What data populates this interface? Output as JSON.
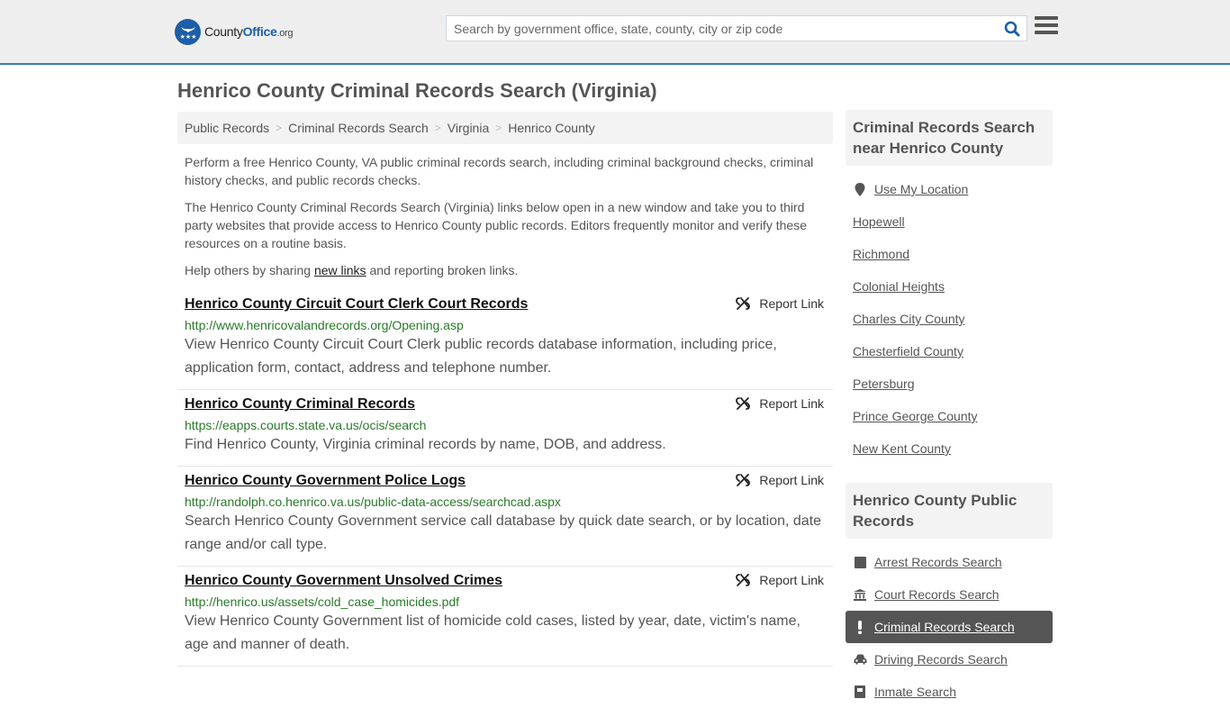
{
  "header": {
    "logo": {
      "prefix": "County",
      "brand": "Office",
      "tld": ".org"
    },
    "search": {
      "placeholder": "Search by government office, state, county, city or zip code",
      "value": ""
    },
    "search_icon": "search-icon",
    "menu_icon": "hamburger-menu-icon"
  },
  "page": {
    "title": "Henrico County Criminal Records Search (Virginia)"
  },
  "breadcrumb": [
    {
      "label": "Public Records"
    },
    {
      "label": "Criminal Records Search"
    },
    {
      "label": "Virginia"
    },
    {
      "label": "Henrico County"
    }
  ],
  "intro": {
    "p1": "Perform a free Henrico County, VA public criminal records search, including criminal background checks, criminal history checks, and public records checks.",
    "p2": "The Henrico County Criminal Records Search (Virginia) links below open in a new window and take you to third party websites that provide access to Henrico County public records. Editors frequently monitor and verify these resources on a routine basis.",
    "p3_before": "Help others by sharing ",
    "p3_link": "new links",
    "p3_after": " and reporting broken links."
  },
  "records": [
    {
      "title": "Henrico County Circuit Court Clerk Court Records",
      "url": "http://www.henricovalandrecords.org/Opening.asp",
      "description": "View Henrico County Circuit Court Clerk public records database information, including price, application form, contact, address and telephone number.",
      "report_label": "Report Link"
    },
    {
      "title": "Henrico County Criminal Records",
      "url": "https://eapps.courts.state.va.us/ocis/search",
      "description": "Find Henrico County, Virginia criminal records by name, DOB, and address.",
      "report_label": "Report Link"
    },
    {
      "title": "Henrico County Government Police Logs",
      "url": "http://randolph.co.henrico.va.us/public-data-access/searchcad.aspx",
      "description": "Search Henrico County Government service call database by quick date search, or by location, date range and/or call type.",
      "report_label": "Report Link"
    },
    {
      "title": "Henrico County Government Unsolved Crimes",
      "url": "http://henrico.us/assets/cold_case_homicides.pdf",
      "description": "View Henrico County Government list of homicide cold cases, listed by year, date, victim's name, age and manner of death.",
      "report_label": "Report Link"
    }
  ],
  "sidebar": {
    "near": {
      "heading": "Criminal Records Search near Henrico County",
      "use_location": "Use My Location",
      "items": [
        "Hopewell",
        "Richmond",
        "Colonial Heights",
        "Charles City County",
        "Chesterfield County",
        "Petersburg",
        "Prince George County",
        "New Kent County"
      ]
    },
    "public_records": {
      "heading": "Henrico County Public Records",
      "items": [
        {
          "label": "Arrest Records Search",
          "icon": "square-icon",
          "active": false
        },
        {
          "label": "Court Records Search",
          "icon": "courthouse-icon",
          "active": false
        },
        {
          "label": "Criminal Records Search",
          "icon": "exclamation-icon",
          "active": true
        },
        {
          "label": "Driving Records Search",
          "icon": "car-icon",
          "active": false
        },
        {
          "label": "Inmate Search",
          "icon": "inmate-icon",
          "active": false
        }
      ]
    }
  },
  "colors": {
    "brand_blue": "#1d5ea8",
    "header_border": "#3a7bb0",
    "url_green": "#2a7a2a",
    "active_bg": "#555555"
  }
}
